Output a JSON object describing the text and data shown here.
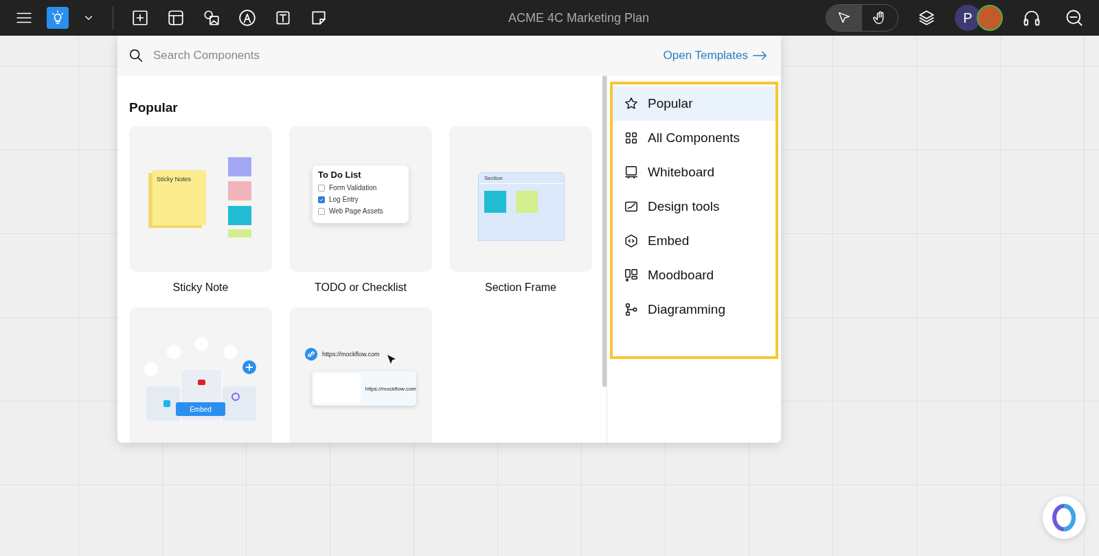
{
  "toolbar": {
    "title": "ACME 4C Marketing Plan",
    "modes": [
      {
        "kind": "select",
        "selected": true
      },
      {
        "kind": "hand",
        "selected": false
      }
    ],
    "avatar_letter": "P"
  },
  "panel": {
    "search": {
      "placeholder": "Search Components"
    },
    "templates_link": "Open Templates",
    "section_title": "Popular",
    "cards": [
      {
        "kind": "sticky",
        "label": "Sticky Note",
        "preview": {
          "note": "Sticky Notes"
        }
      },
      {
        "kind": "todo",
        "label": "TODO or Checklist",
        "preview": {
          "title": "To Do List",
          "items": [
            {
              "text": "Form Validation",
              "checked": false
            },
            {
              "text": "Log Entry",
              "checked": true
            },
            {
              "text": "Web Page Assets",
              "checked": false
            }
          ]
        }
      },
      {
        "kind": "section",
        "label": "Section Frame",
        "preview": {
          "title": "Section"
        }
      },
      {
        "kind": "embed",
        "preview": {
          "button": "Embed"
        }
      },
      {
        "kind": "link",
        "preview": {
          "url": "https://mockflow.com",
          "caption": "https://mockflow.com"
        }
      }
    ],
    "categories": [
      {
        "kind": "star",
        "label": "Popular",
        "selected": true
      },
      {
        "kind": "grid",
        "label": "All Components",
        "selected": false
      },
      {
        "kind": "board",
        "label": "Whiteboard",
        "selected": false
      },
      {
        "kind": "pen",
        "label": "Design tools",
        "selected": false
      },
      {
        "kind": "hex",
        "label": "Embed",
        "selected": false
      },
      {
        "kind": "mood",
        "label": "Moodboard",
        "selected": false
      },
      {
        "kind": "diagram",
        "label": "Diagramming",
        "selected": false
      }
    ]
  }
}
